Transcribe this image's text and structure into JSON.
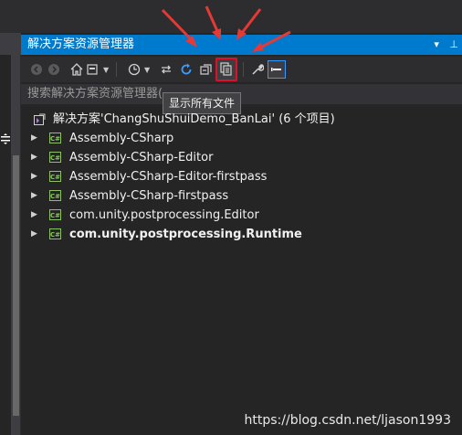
{
  "panel": {
    "title": "解决方案资源管理器",
    "title_icons": [
      "dropdown-icon",
      "pin-icon",
      "close-icon"
    ]
  },
  "toolbar": {
    "buttons": [
      "back-icon",
      "forward-icon",
      "home-icon",
      "switch-views-icon",
      "history-icon",
      "sync-icon",
      "refresh-icon",
      "collapse-all-icon",
      "show-all-files-icon",
      "properties-icon",
      "preview-icon"
    ],
    "tooltip": "显示所有文件"
  },
  "search": {
    "placeholder": "搜索解决方案资源管理器("
  },
  "tree": {
    "solution": "解决方案'ChangShuShuiDemo_BanLai' (6 个项目)",
    "items": [
      {
        "label": "Assembly-CSharp",
        "bold": false
      },
      {
        "label": "Assembly-CSharp-Editor",
        "bold": false
      },
      {
        "label": "Assembly-CSharp-Editor-firstpass",
        "bold": false
      },
      {
        "label": "Assembly-CSharp-firstpass",
        "bold": false
      },
      {
        "label": "com.unity.postprocessing.Editor",
        "bold": false
      },
      {
        "label": "com.unity.postprocessing.Runtime",
        "bold": true
      }
    ],
    "icon_text": "C#"
  },
  "watermark": "https://blog.csdn.net/ljason1993",
  "colors": {
    "accent": "#007acc",
    "highlight_border": "#e0102a",
    "arrow": "#e53935",
    "csharp_icon": "#8cc265"
  }
}
